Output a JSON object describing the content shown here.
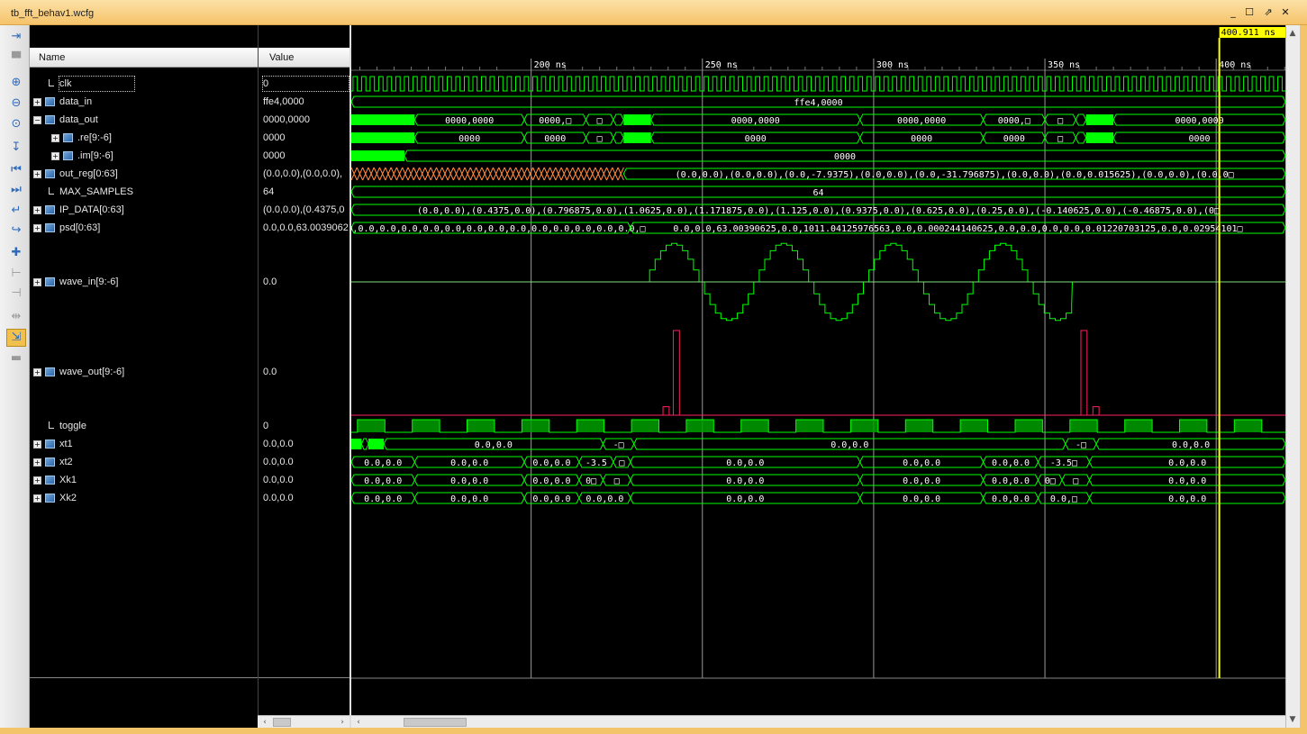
{
  "window": {
    "title": "tb_fft_behav1.wcfg",
    "btn_min": "_",
    "btn_max": "☐",
    "btn_restore": "⇗",
    "btn_close": "✕"
  },
  "toolbar": [
    {
      "name": "scope-icon",
      "glyph": "⇥",
      "disabled": false
    },
    {
      "name": "save-icon",
      "glyph": "▀",
      "disabled": true
    },
    {
      "name": "zoom-in-icon",
      "glyph": "⊕",
      "disabled": false
    },
    {
      "name": "zoom-out-icon",
      "glyph": "⊖",
      "disabled": false
    },
    {
      "name": "zoom-fit-icon",
      "glyph": "⊙",
      "disabled": false
    },
    {
      "name": "cursor-to-zero-icon",
      "glyph": "↧",
      "disabled": false
    },
    {
      "name": "go-to-start-icon",
      "glyph": "⏮",
      "disabled": false
    },
    {
      "name": "go-to-end-icon",
      "glyph": "⏭",
      "disabled": false
    },
    {
      "name": "previous-transition-icon",
      "glyph": "↵",
      "disabled": false
    },
    {
      "name": "next-transition-icon",
      "glyph": "↪",
      "disabled": false
    },
    {
      "name": "add-marker-icon",
      "glyph": "✚",
      "disabled": false
    },
    {
      "name": "previous-marker-icon",
      "glyph": "⊢",
      "disabled": true
    },
    {
      "name": "next-marker-icon",
      "glyph": "⊣",
      "disabled": true
    },
    {
      "name": "swap-cursors-icon",
      "glyph": "⇹",
      "disabled": true
    },
    {
      "name": "snap-to-transition-icon",
      "glyph": "⇲",
      "disabled": false,
      "active": true
    },
    {
      "name": "floating-ruler-icon",
      "glyph": "▬",
      "disabled": true
    }
  ],
  "columns": {
    "name": "Name",
    "value": "Value"
  },
  "signals": [
    {
      "key": "clk",
      "name": "clk",
      "value": "0",
      "type": "bit",
      "indent": 0,
      "expand": false,
      "selected": true
    },
    {
      "key": "data_in",
      "name": "data_in",
      "value": "ffe4,0000",
      "type": "bus",
      "indent": 0,
      "expand": "+"
    },
    {
      "key": "data_out",
      "name": "data_out",
      "value": "0000,0000",
      "type": "bus",
      "indent": 0,
      "expand": "-"
    },
    {
      "key": "re",
      "name": ".re[9:-6]",
      "value": "0000",
      "type": "bus",
      "indent": 1,
      "expand": "+"
    },
    {
      "key": "im",
      "name": ".im[9:-6]",
      "value": "0000",
      "type": "bus",
      "indent": 1,
      "expand": "+"
    },
    {
      "key": "out_reg",
      "name": "out_reg[0:63]",
      "value": "(0.0,0.0),(0.0,0.0),",
      "type": "bus",
      "indent": 0,
      "expand": "+"
    },
    {
      "key": "max_samples",
      "name": "MAX_SAMPLES",
      "value": "64",
      "type": "bit",
      "indent": 0,
      "expand": false
    },
    {
      "key": "ip_data",
      "name": "IP_DATA[0:63]",
      "value": "(0.0,0.0),(0.4375,0",
      "type": "bus",
      "indent": 0,
      "expand": "+"
    },
    {
      "key": "psd",
      "name": "psd[0:63]",
      "value": "0.0,0.0,63.0039062",
      "type": "bus",
      "indent": 0,
      "expand": "+"
    },
    {
      "key": "wave_in",
      "name": "wave_in[9:-6]",
      "value": "0.0",
      "type": "bus",
      "indent": 0,
      "expand": "+"
    },
    {
      "key": "wave_out",
      "name": "wave_out[9:-6]",
      "value": "0.0",
      "type": "bus",
      "indent": 0,
      "expand": "+"
    },
    {
      "key": "toggle",
      "name": "toggle",
      "value": "0",
      "type": "bit",
      "indent": 0,
      "expand": false
    },
    {
      "key": "xt1",
      "name": "xt1",
      "value": "0.0,0.0",
      "type": "bus",
      "indent": 0,
      "expand": "+"
    },
    {
      "key": "xt2",
      "name": "xt2",
      "value": "0.0,0.0",
      "type": "bus",
      "indent": 0,
      "expand": "+"
    },
    {
      "key": "xk1",
      "name": "Xk1",
      "value": "0.0,0.0",
      "type": "bus",
      "indent": 0,
      "expand": "+"
    },
    {
      "key": "xk2",
      "name": "Xk2",
      "value": "0.0,0.0",
      "type": "bus",
      "indent": 0,
      "expand": "+"
    }
  ],
  "timeline": {
    "view_start_ns": 147.5,
    "view_end_ns": 420.2,
    "ticks": [
      {
        "t": 200,
        "label": "200 ns"
      },
      {
        "t": 250,
        "label": "250 ns"
      },
      {
        "t": 300,
        "label": "300 ns"
      },
      {
        "t": 350,
        "label": "350 ns"
      },
      {
        "t": 400,
        "label": "400 ns"
      }
    ],
    "cursor_ns": 400.911,
    "cursor_label": "400.911 ns"
  },
  "colors": {
    "wave": "#00ff00",
    "overflow": "#ff8c40",
    "wave_out": "#ff2060",
    "cursor": "#ffff00",
    "grid": "#9a9a9a",
    "accent_titlebar": "#f6c36a"
  },
  "waves": {
    "data_in": {
      "segments": [
        {
          "t0": 147.5,
          "t1": 420.2,
          "label": "ffe4,0000"
        }
      ]
    },
    "data_out": {
      "segments": [
        {
          "t0": 147.5,
          "t1": 166,
          "fill": true
        },
        {
          "t0": 166,
          "t1": 198,
          "label": "0000,0000"
        },
        {
          "t0": 198,
          "t1": 216,
          "label": "0000,□"
        },
        {
          "t0": 216,
          "t1": 224,
          "label": "□"
        },
        {
          "t0": 224,
          "t1": 227,
          "label": ""
        },
        {
          "t0": 227,
          "t1": 235,
          "fill": true
        },
        {
          "t0": 235,
          "t1": 296,
          "label": "0000,0000"
        },
        {
          "t0": 296,
          "t1": 332,
          "label": "0000,0000"
        },
        {
          "t0": 332,
          "t1": 350,
          "label": "0000,□"
        },
        {
          "t0": 350,
          "t1": 359,
          "label": "□"
        },
        {
          "t0": 359,
          "t1": 362,
          "label": ""
        },
        {
          "t0": 362,
          "t1": 370,
          "fill": true
        },
        {
          "t0": 370,
          "t1": 420.2,
          "label": "0000,0000"
        }
      ]
    },
    "re": {
      "segments": [
        {
          "t0": 147.5,
          "t1": 166,
          "fill": true
        },
        {
          "t0": 166,
          "t1": 198,
          "label": "0000"
        },
        {
          "t0": 198,
          "t1": 216,
          "label": "0000"
        },
        {
          "t0": 216,
          "t1": 224,
          "label": "□"
        },
        {
          "t0": 224,
          "t1": 227,
          "label": ""
        },
        {
          "t0": 227,
          "t1": 235,
          "fill": true
        },
        {
          "t0": 235,
          "t1": 296,
          "label": "0000"
        },
        {
          "t0": 296,
          "t1": 332,
          "label": "0000"
        },
        {
          "t0": 332,
          "t1": 350,
          "label": "0000"
        },
        {
          "t0": 350,
          "t1": 359,
          "label": "□"
        },
        {
          "t0": 359,
          "t1": 362,
          "label": ""
        },
        {
          "t0": 362,
          "t1": 370,
          "fill": true
        },
        {
          "t0": 370,
          "t1": 420.2,
          "label": "0000"
        }
      ]
    },
    "im": {
      "segments": [
        {
          "t0": 147.5,
          "t1": 163,
          "fill": true
        },
        {
          "t0": 163,
          "t1": 420.2,
          "label": "0000"
        }
      ]
    },
    "out_reg": {
      "xuntil": 227,
      "segments": [
        {
          "t0": 227,
          "t1": 420.2,
          "label": "(0.0,0.0),(0.0,0.0),(0.0,-7.9375),(0.0,0.0),(0.0,-31.796875),(0.0,0.0),(0.0,0.015625),(0.0,0.0),(0.0,0□"
        }
      ]
    },
    "max_samples": {
      "segments": [
        {
          "t0": 147.5,
          "t1": 420.2,
          "label": "64"
        }
      ]
    },
    "ip_data": {
      "segments": [
        {
          "t0": 147.5,
          "t1": 420.2,
          "label": "(0.0,0.0),(0.4375,0.0),(0.796875,0.0),(1.0625,0.0),(1.171875,0.0),(1.125,0.0),(0.9375,0.0),(0.625,0.0),(0.25,0.0),(-0.140625,0.0),(-0.46875,0.0),(0□"
        }
      ]
    },
    "psd": {
      "segments": [
        {
          "t0": 147.5,
          "t1": 229,
          "label": "0.0,0.0,0.0,0.0,0.0,0.0,0.0,0.0,0.0,0.0,0.0,0.0,0.0,0.0,□"
        },
        {
          "t0": 229,
          "t1": 420.2,
          "label": "0.0,0.0,63.00390625,0.0,1011.04125976563,0.0,0.000244140625,0.0,0.0,0.0,0.0,0.01220703125,0.0,0.02954101□"
        }
      ]
    },
    "wave_in": {
      "start": 233,
      "end": 358,
      "step": 1.6,
      "period": 32,
      "amp": 0.95
    },
    "wave_out": {
      "pulses": [
        {
          "t": 238.5,
          "w": 1.8,
          "h": 0.1
        },
        {
          "t": 241.5,
          "w": 1.8,
          "h": 1.0
        },
        {
          "t": 253,
          "w": 1.8,
          "h": 0.0
        },
        {
          "t": 360.5,
          "w": 1.8,
          "h": 1.0
        },
        {
          "t": 364,
          "w": 1.8,
          "h": 0.1
        }
      ]
    },
    "toggle": {
      "period": 16,
      "start": 149.3
    },
    "xt1": {
      "segments": [
        {
          "t0": 147.5,
          "t1": 150.5,
          "fill": true
        },
        {
          "t0": 150.5,
          "t1": 152.5,
          "label": ""
        },
        {
          "t0": 152.5,
          "t1": 157,
          "fill": true
        },
        {
          "t0": 157,
          "t1": 221,
          "label": "0.0,0.0"
        },
        {
          "t0": 221,
          "t1": 230,
          "label": "-□"
        },
        {
          "t0": 230,
          "t1": 356,
          "label": "0.0,0.0"
        },
        {
          "t0": 356,
          "t1": 365,
          "label": "-□"
        },
        {
          "t0": 365,
          "t1": 420.2,
          "label": "0.0,0.0"
        }
      ]
    },
    "xt2": {
      "segments": [
        {
          "t0": 147.5,
          "t1": 166,
          "label": "0.0,0.0"
        },
        {
          "t0": 166,
          "t1": 198,
          "label": "0.0,0.0"
        },
        {
          "t0": 198,
          "t1": 214,
          "label": "0.0,0.0"
        },
        {
          "t0": 214,
          "t1": 224,
          "label": "-3.5"
        },
        {
          "t0": 224,
          "t1": 229,
          "label": "□"
        },
        {
          "t0": 229,
          "t1": 296,
          "label": "0.0,0.0"
        },
        {
          "t0": 296,
          "t1": 332,
          "label": "0.0,0.0"
        },
        {
          "t0": 332,
          "t1": 348,
          "label": "0.0,0.0"
        },
        {
          "t0": 348,
          "t1": 363,
          "label": "-3.5□"
        },
        {
          "t0": 363,
          "t1": 420.2,
          "label": "0.0,0.0"
        }
      ]
    },
    "xk1": {
      "segments": [
        {
          "t0": 147.5,
          "t1": 166,
          "label": "0.0,0.0"
        },
        {
          "t0": 166,
          "t1": 198,
          "label": "0.0,0.0"
        },
        {
          "t0": 198,
          "t1": 214,
          "label": "0.0,0.0"
        },
        {
          "t0": 214,
          "t1": 221,
          "label": "0□"
        },
        {
          "t0": 221,
          "t1": 229,
          "label": "□"
        },
        {
          "t0": 229,
          "t1": 296,
          "label": "0.0,0.0"
        },
        {
          "t0": 296,
          "t1": 332,
          "label": "0.0,0.0"
        },
        {
          "t0": 332,
          "t1": 348,
          "label": "0.0,0.0"
        },
        {
          "t0": 348,
          "t1": 355,
          "label": "0□"
        },
        {
          "t0": 355,
          "t1": 363,
          "label": "□"
        },
        {
          "t0": 363,
          "t1": 420.2,
          "label": "0.0,0.0"
        }
      ]
    },
    "xk2": {
      "segments": [
        {
          "t0": 147.5,
          "t1": 166,
          "label": "0.0,0.0"
        },
        {
          "t0": 166,
          "t1": 198,
          "label": "0.0,0.0"
        },
        {
          "t0": 198,
          "t1": 214,
          "label": "0.0,0.0"
        },
        {
          "t0": 214,
          "t1": 229,
          "label": "0.0,0.0"
        },
        {
          "t0": 229,
          "t1": 296,
          "label": "0.0,0.0"
        },
        {
          "t0": 296,
          "t1": 332,
          "label": "0.0,0.0"
        },
        {
          "t0": 332,
          "t1": 348,
          "label": "0.0,0.0"
        },
        {
          "t0": 348,
          "t1": 363,
          "label": "0.0,□"
        },
        {
          "t0": 363,
          "t1": 420.2,
          "label": "0.0,0.0"
        }
      ]
    }
  },
  "scroll": {
    "left": "‹",
    "right": "›",
    "up": "▲",
    "down": "▼"
  }
}
